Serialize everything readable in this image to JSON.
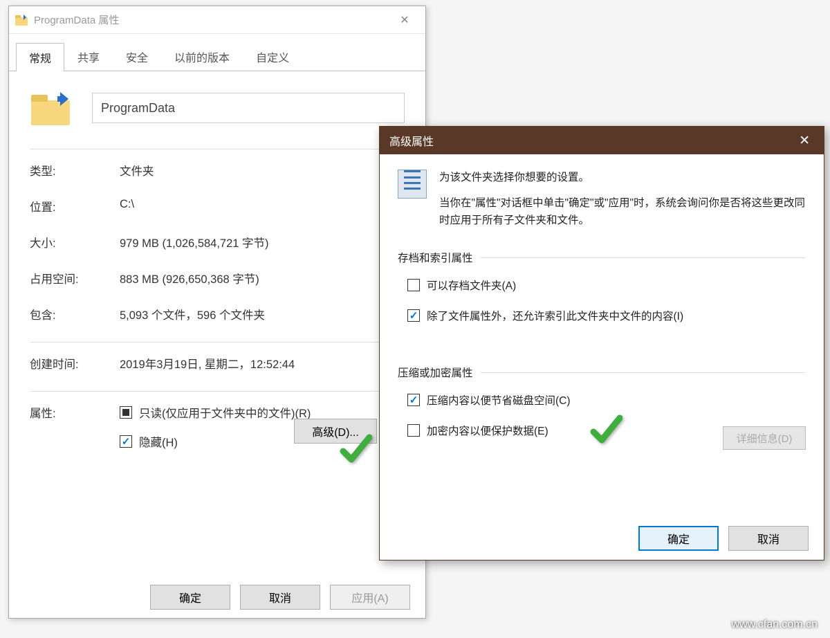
{
  "props": {
    "title": "ProgramData 属性",
    "tabs": [
      "常规",
      "共享",
      "安全",
      "以前的版本",
      "自定义"
    ],
    "name_value": "ProgramData",
    "rows": {
      "type_label": "类型:",
      "type_value": "文件夹",
      "location_label": "位置:",
      "location_value": "C:\\",
      "size_label": "大小:",
      "size_value": "979 MB (1,026,584,721 字节)",
      "sizeondisk_label": "占用空间:",
      "sizeondisk_value": "883 MB (926,650,368 字节)",
      "contains_label": "包含:",
      "contains_value": "5,093 个文件，596 个文件夹",
      "created_label": "创建时间:",
      "created_value": "2019年3月19日, 星期二，12:52:44",
      "attr_label": "属性:",
      "readonly_label": "只读(仅应用于文件夹中的文件)(R)",
      "hidden_label": "隐藏(H)"
    },
    "advanced_button": "高级(D)...",
    "buttons": {
      "ok": "确定",
      "cancel": "取消",
      "apply": "应用(A)"
    }
  },
  "adv": {
    "title": "高级属性",
    "intro1": "为该文件夹选择你想要的设置。",
    "intro2": "当你在\"属性\"对话框中单击\"确定\"或\"应用\"时，系统会询问你是否将这些更改同时应用于所有子文件夹和文件。",
    "group1_title": "存档和索引属性",
    "archive_label": "可以存档文件夹(A)",
    "index_label": "除了文件属性外，还允许索引此文件夹中文件的内容(I)",
    "group2_title": "压缩或加密属性",
    "compress_label": "压缩内容以便节省磁盘空间(C)",
    "encrypt_label": "加密内容以便保护数据(E)",
    "details_button": "详细信息(D)",
    "buttons": {
      "ok": "确定",
      "cancel": "取消"
    }
  },
  "watermark": "www.cfan.com.cn"
}
